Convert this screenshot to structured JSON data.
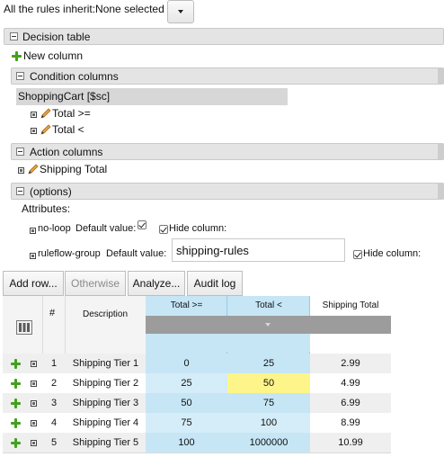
{
  "inherit": {
    "label": "All the rules inherit:None selected"
  },
  "sections": {
    "decision_table": "Decision table",
    "new_column": "New column",
    "condition_columns": "Condition columns",
    "pattern": "ShoppingCart [$sc]",
    "conditions": [
      "Total >=",
      "Total <"
    ],
    "action_columns": "Action columns",
    "actions": [
      "Shipping Total"
    ],
    "options": "(options)"
  },
  "attributes": {
    "label": "Attributes:",
    "no_loop": {
      "name": "no-loop",
      "default_label": "Default value:",
      "hide_label": "Hide column:",
      "default_checked": true,
      "hide_checked": true
    },
    "ruleflow_group": {
      "name": "ruleflow-group",
      "default_label": "Default value:",
      "value": "shipping-rules",
      "hide_label": "Hide column:",
      "hide_checked": true
    }
  },
  "toolbar": {
    "add_row": "Add row...",
    "otherwise": "Otherwise",
    "analyze": "Analyze...",
    "audit_log": "Audit log"
  },
  "table": {
    "headers": {
      "number": "#",
      "description": "Description",
      "total_gte": "Total >=",
      "total_lt": "Total <",
      "shipping_total": "Shipping Total"
    },
    "rows": [
      {
        "num": "1",
        "desc": "Shipping Tier 1",
        "gte": "0",
        "lt": "25",
        "ship": "2.99"
      },
      {
        "num": "2",
        "desc": "Shipping Tier 2",
        "gte": "25",
        "lt": "50",
        "ship": "4.99"
      },
      {
        "num": "3",
        "desc": "Shipping Tier 3",
        "gte": "50",
        "lt": "75",
        "ship": "6.99"
      },
      {
        "num": "4",
        "desc": "Shipping Tier 4",
        "gte": "75",
        "lt": "100",
        "ship": "8.99"
      },
      {
        "num": "5",
        "desc": "Shipping Tier 5",
        "gte": "100",
        "lt": "1000000",
        "ship": "10.99"
      }
    ],
    "selected_cell_color": "#fdf58a",
    "condition_header_color": "#c6e6f5"
  }
}
